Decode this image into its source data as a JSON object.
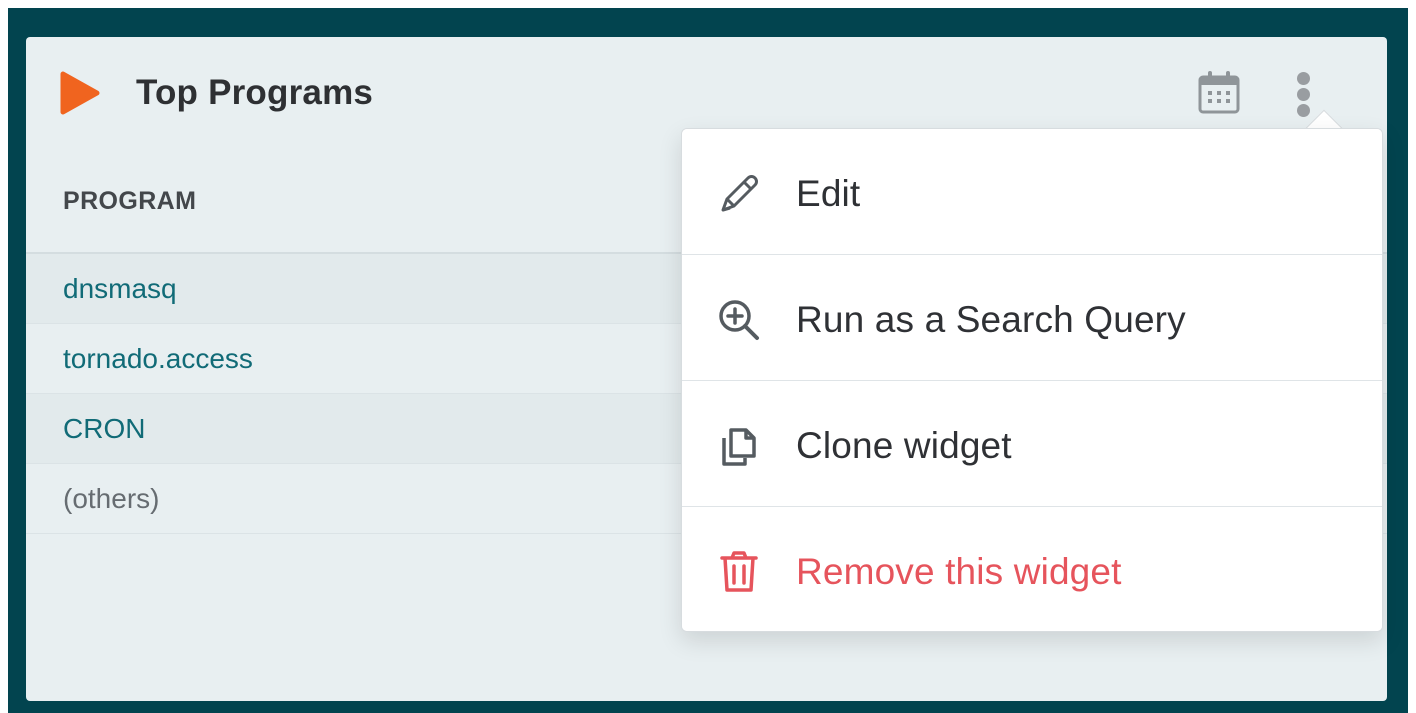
{
  "widget": {
    "title": "Top Programs"
  },
  "table": {
    "headers": [
      "PROGRAM"
    ],
    "rows": [
      {
        "program": "dnsmasq",
        "type": "link"
      },
      {
        "program": "tornado.access",
        "type": "link"
      },
      {
        "program": "CRON",
        "type": "link"
      },
      {
        "program": "(others)",
        "type": "muted"
      }
    ]
  },
  "menu": {
    "items": [
      {
        "label": "Edit",
        "icon": "pencil-icon"
      },
      {
        "label": "Run as a Search Query",
        "icon": "zoom-in-icon"
      },
      {
        "label": "Clone widget",
        "icon": "copy-icon"
      },
      {
        "label": "Remove this widget",
        "icon": "trash-icon",
        "variant": "danger"
      }
    ]
  },
  "icons": {
    "brand": "play-icon",
    "calendar": "calendar-icon",
    "more": "more-vertical-icon"
  },
  "colors": {
    "frame": "#02444f",
    "widget_bg": "#e8eff1",
    "accent_orange": "#f0641f",
    "link_teal": "#116b77",
    "danger_red": "#e6545c"
  }
}
